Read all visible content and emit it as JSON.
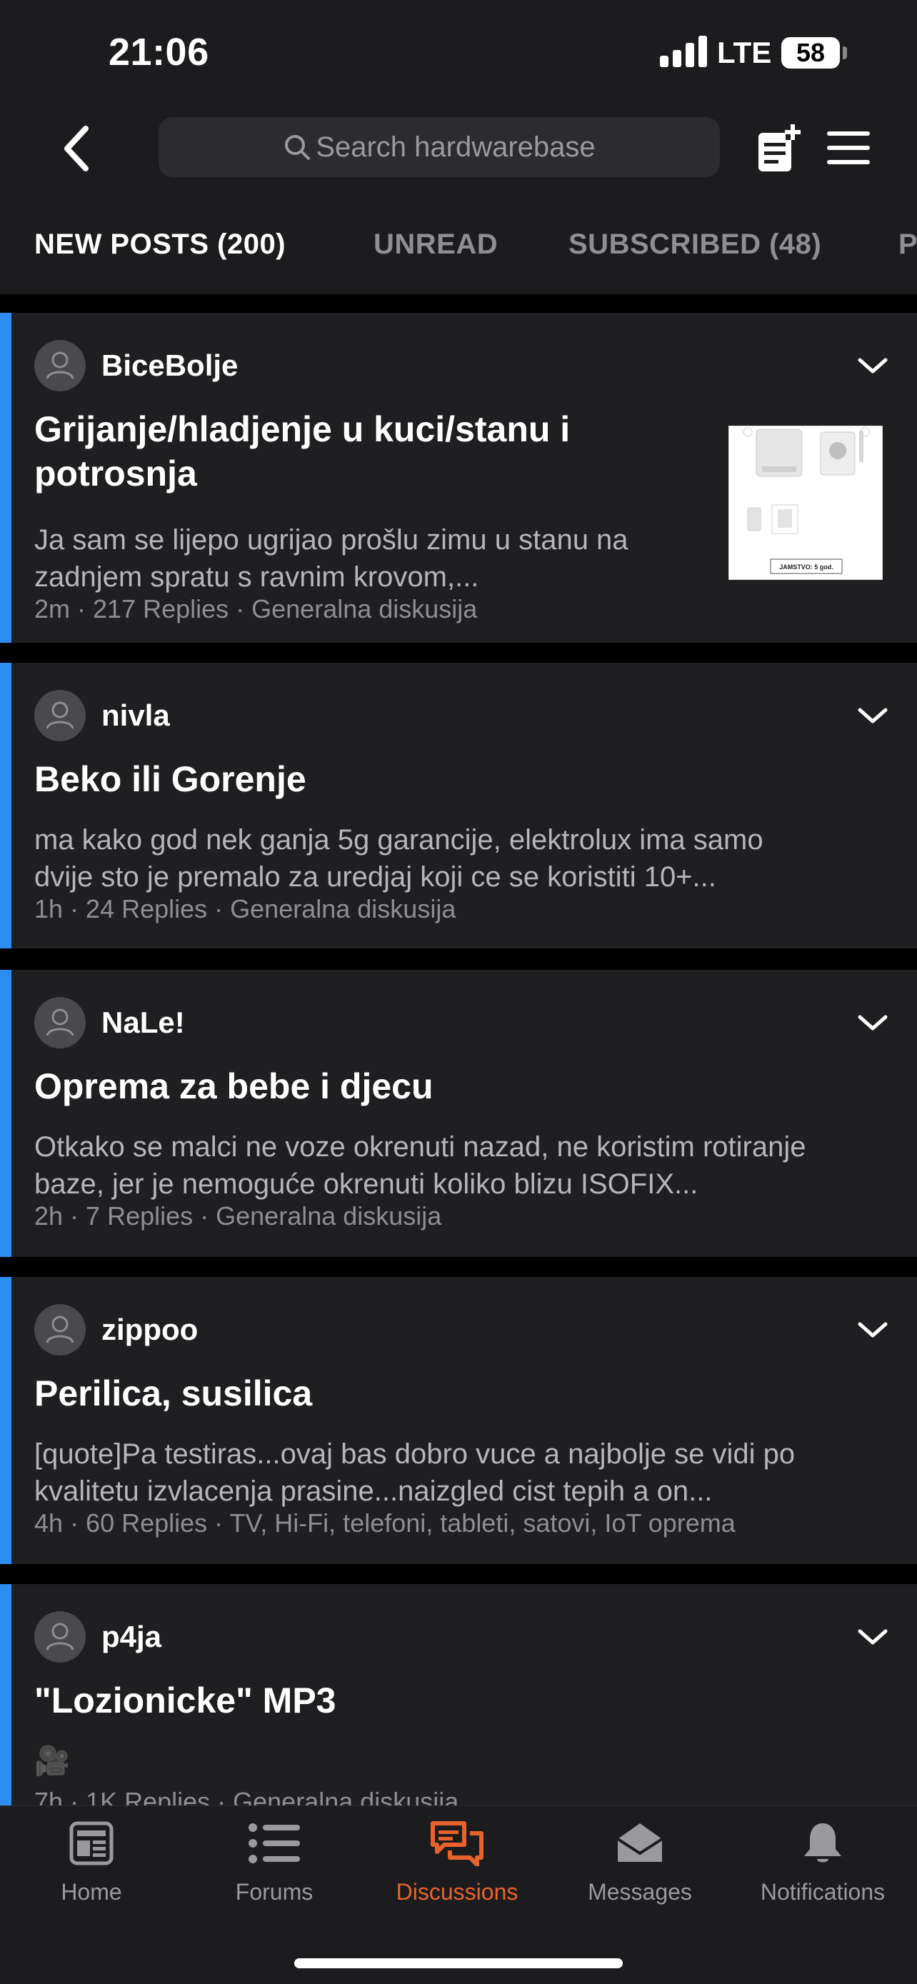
{
  "status_bar": {
    "time": "21:06",
    "network": "LTE",
    "battery": "58"
  },
  "header": {
    "search_placeholder": "Search hardwarebase",
    "tabs": [
      {
        "label": "NEW POSTS (200)",
        "active": true
      },
      {
        "label": "UNREAD",
        "active": false
      },
      {
        "label": "SUBSCRIBED (48)",
        "active": false
      },
      {
        "label": "P",
        "active": false
      }
    ]
  },
  "posts": [
    {
      "author": "BiceBolje",
      "title_lines": [
        "Grijanje/hladjenje u kuci/stanu i",
        "potrosnja"
      ],
      "excerpt_lines": [
        "Ja sam se lijepo ugrijao prošlu zimu u stanu na",
        "zadnjem spratu s ravnim krovom,..."
      ],
      "time": "2m",
      "replies": "217 Replies",
      "forum": "Generalna diskusija",
      "thumbnail": {
        "label": "JAMSTVO: 5 god."
      }
    },
    {
      "author": "nivla",
      "title_lines": [
        "Beko ili Gorenje"
      ],
      "excerpt_lines": [
        "ma kako god nek ganja 5g garancije, elektrolux ima samo",
        "dvije sto je premalo za uredjaj koji ce se koristiti 10+..."
      ],
      "time": "1h",
      "replies": "24 Replies",
      "forum": "Generalna diskusija"
    },
    {
      "author": "NaLe!",
      "title_lines": [
        "Oprema za bebe i djecu"
      ],
      "excerpt_lines": [
        "Otkako se malci ne voze okrenuti nazad, ne koristim rotiranje",
        "baze, jer je nemoguće okrenuti koliko blizu ISOFIX..."
      ],
      "time": "2h",
      "replies": "7 Replies",
      "forum": "Generalna diskusija"
    },
    {
      "author": "zippoo",
      "title_lines": [
        "Perilica, susilica"
      ],
      "excerpt_lines": [
        "[quote]Pa testiras...ovaj bas dobro vuce a najbolje se vidi po",
        "kvalitetu izvlacenja prasine...naizgled cist tepih a on..."
      ],
      "time": "4h",
      "replies": "60 Replies",
      "forum": "TV, Hi-Fi, telefoni, tableti, satovi, IoT oprema"
    },
    {
      "author": "p4ja",
      "title_lines": [
        "\"Lozionicke\" MP3"
      ],
      "excerpt_lines": [
        "🎥"
      ],
      "time": "7h",
      "replies": "1K Replies",
      "forum": "Generalna diskusija"
    }
  ],
  "tabbar": {
    "items": [
      {
        "label": "Home",
        "icon": "home-icon",
        "active": false
      },
      {
        "label": "Forums",
        "icon": "list-icon",
        "active": false
      },
      {
        "label": "Discussions",
        "icon": "chat-bubbles-icon",
        "active": true
      },
      {
        "label": "Messages",
        "icon": "envelope-icon",
        "active": false
      },
      {
        "label": "Notifications",
        "icon": "bell-icon",
        "active": false
      }
    ]
  },
  "colors": {
    "accent_blue": "#2d8cf0",
    "active_orange": "#e8632c",
    "card_bg": "#1f1f21",
    "bar_bg": "#1c1c1e"
  }
}
